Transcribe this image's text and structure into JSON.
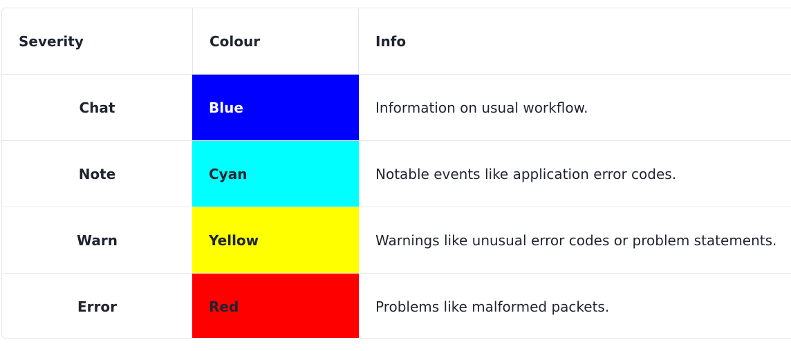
{
  "table": {
    "headers": {
      "severity": "Severity",
      "colour": "Colour",
      "info": "Info"
    },
    "rows": [
      {
        "severity": "Chat",
        "colour": "Blue",
        "info": "Information on usual workflow.",
        "bg": "#0000ff",
        "fg": "#ffffff"
      },
      {
        "severity": "Note",
        "colour": "Cyan",
        "info": "Notable events like application error codes.",
        "bg": "#00ffff",
        "fg": "#1f2430"
      },
      {
        "severity": "Warn",
        "colour": "Yellow",
        "info": "Warnings like unusual error codes or problem statements.",
        "bg": "#ffff00",
        "fg": "#1f2430"
      },
      {
        "severity": "Error",
        "colour": "Red",
        "info": "Problems like malformed packets.",
        "bg": "#ff0000",
        "fg": "#1f2430"
      }
    ]
  }
}
